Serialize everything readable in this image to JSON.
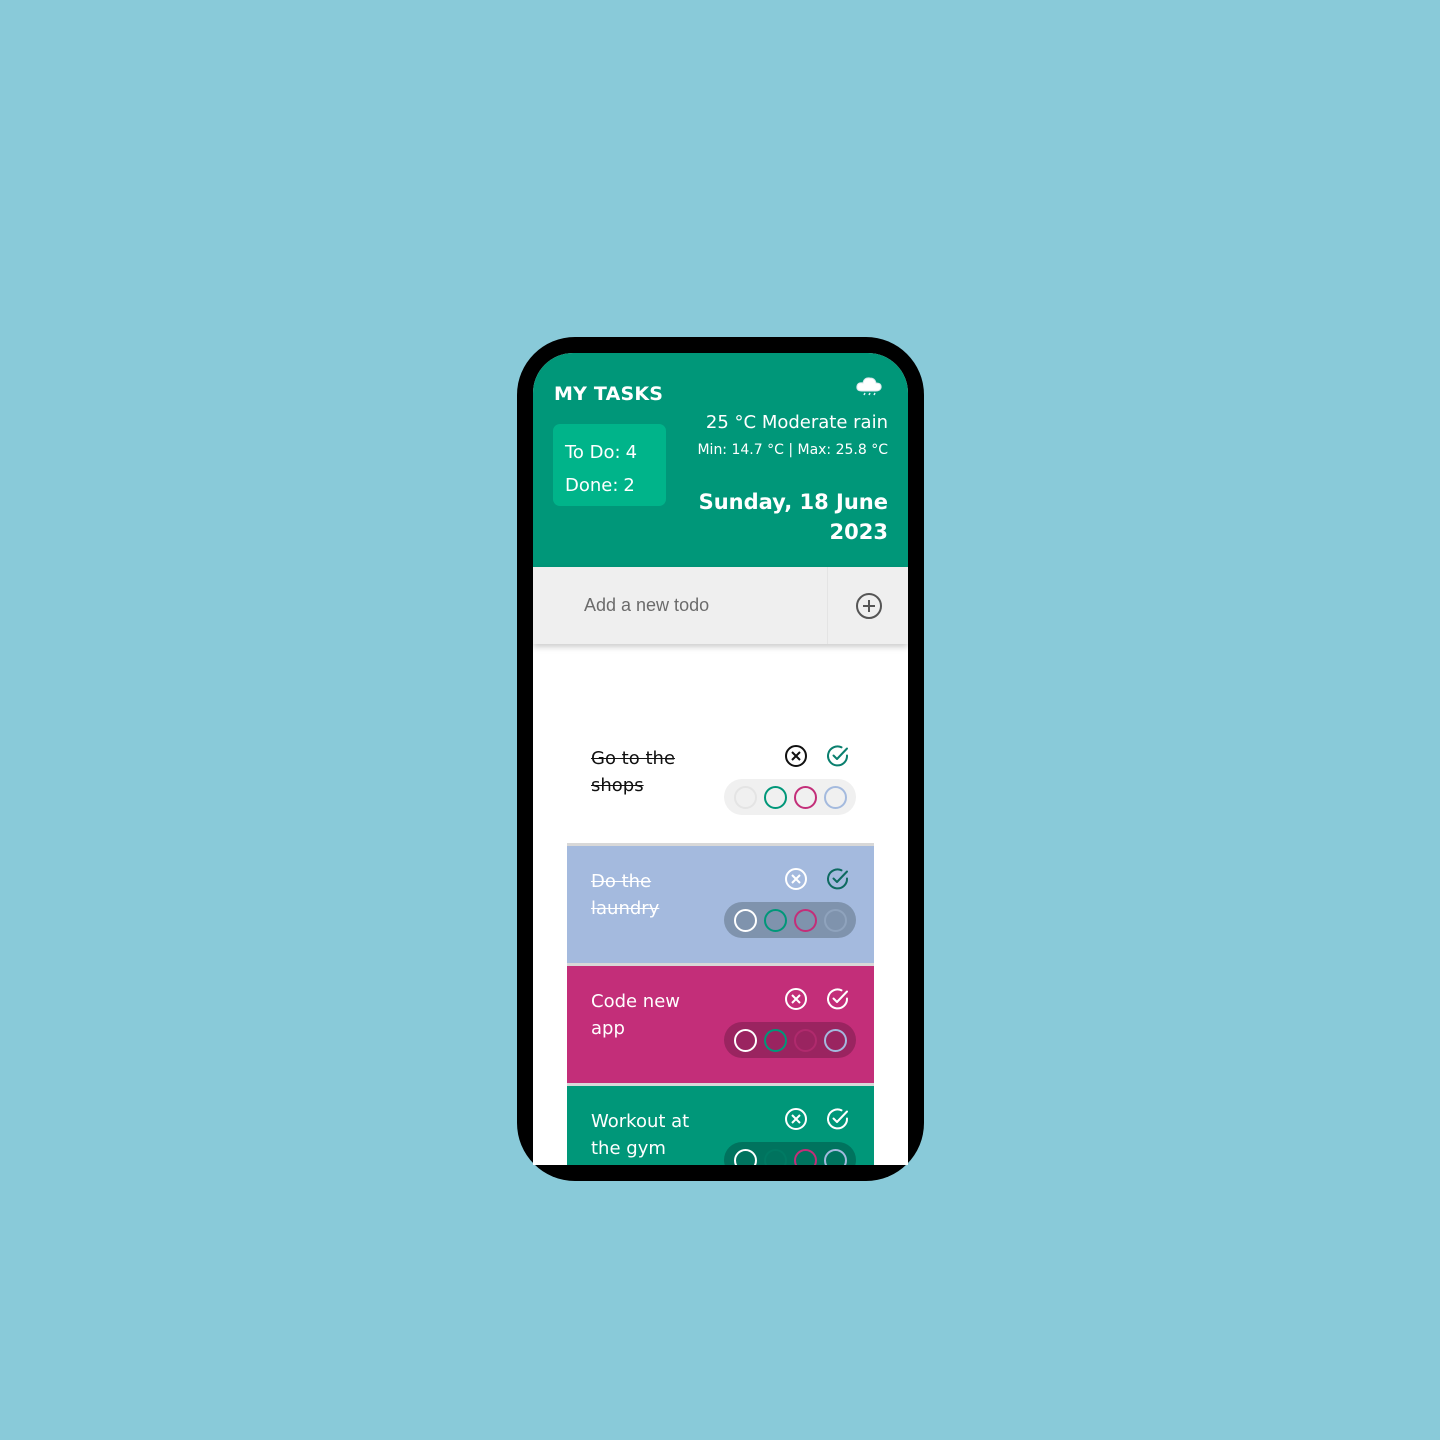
{
  "header": {
    "title": "MY TASKS",
    "todo_label": "To Do:",
    "todo_count": "4",
    "done_label": "Done:",
    "done_count": "2",
    "weather_icon": "cloud-rain-icon",
    "temperature": "25 °C Moderate rain",
    "min_max": "Min: 14.7 °C | Max: 25.8 °C",
    "date": "Sunday, 18 June 2023"
  },
  "add_todo": {
    "placeholder": "Add a new todo",
    "button_icon": "plus-circle-icon"
  },
  "colors": {
    "brand": "#009779",
    "counter_bg": "#00b48a",
    "blue": "#a4bade",
    "pink": "#c32e79",
    "green": "#009779",
    "white": "#ffffff"
  },
  "todos": [
    {
      "text": "Go to the shops",
      "done": true,
      "color": "white"
    },
    {
      "text": "Do the laundry",
      "done": true,
      "color": "blue"
    },
    {
      "text": "Code new app",
      "done": false,
      "color": "pink"
    },
    {
      "text": "Workout at the gym",
      "done": false,
      "color": "green"
    }
  ],
  "palette_options": [
    "white",
    "green",
    "pink",
    "blue"
  ]
}
